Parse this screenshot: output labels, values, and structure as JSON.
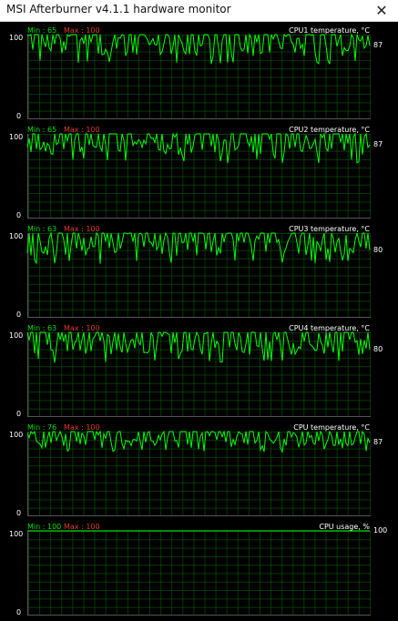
{
  "window": {
    "title": "MSI Afterburner v4.1.1 hardware monitor",
    "close_glyph": "✕"
  },
  "colors": {
    "line": "#00ff00",
    "grid": "#006900",
    "min": "#00e000",
    "max": "#e23a2a"
  },
  "graphs": [
    {
      "name": "CPU1 temperature, °C",
      "min_label": "Min : 65",
      "max_label": "Max : 100",
      "y_max_label": "100",
      "y_min_label": "0",
      "current": "87",
      "current_value": 87,
      "min": 65,
      "max": 100,
      "scale_max": 100
    },
    {
      "name": "CPU2 temperature, °C",
      "min_label": "Min : 65",
      "max_label": "Max : 100",
      "y_max_label": "100",
      "y_min_label": "0",
      "current": "87",
      "current_value": 87,
      "min": 65,
      "max": 100,
      "scale_max": 100
    },
    {
      "name": "CPU3 temperature, °C",
      "min_label": "Min : 63",
      "max_label": "Max : 100",
      "y_max_label": "100",
      "y_min_label": "0",
      "current": "80",
      "current_value": 80,
      "min": 63,
      "max": 100,
      "scale_max": 100
    },
    {
      "name": "CPU4 temperature, °C",
      "min_label": "Min : 63",
      "max_label": "Max : 100",
      "y_max_label": "100",
      "y_min_label": "0",
      "current": "80",
      "current_value": 80,
      "min": 63,
      "max": 100,
      "scale_max": 100
    },
    {
      "name": "CPU temperature, °C",
      "min_label": "Min : 76",
      "max_label": "Max : 100",
      "y_max_label": "100",
      "y_min_label": "0",
      "current": "87",
      "current_value": 87,
      "min": 76,
      "max": 100,
      "scale_max": 100
    },
    {
      "name": "CPU usage, %",
      "min_label": "Min : 100",
      "max_label": "Max : 100",
      "y_max_label": "100",
      "y_min_label": "0",
      "current": "100",
      "current_value": 100,
      "min": 100,
      "max": 100,
      "scale_max": 100
    }
  ]
}
